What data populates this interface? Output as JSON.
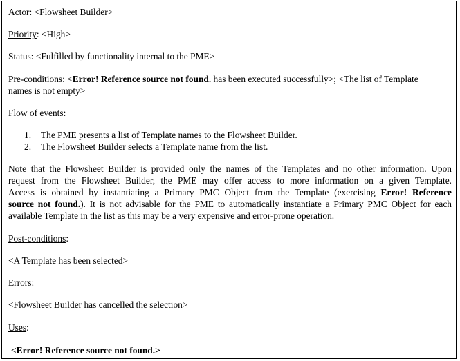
{
  "actor": {
    "label": "Actor",
    "value": "<Flowsheet Builder>"
  },
  "priority": {
    "label": "Priority",
    "value": "<High>"
  },
  "status": {
    "label": "Status",
    "value": "<Fulfilled by functionality internal to the PME>"
  },
  "preconditions": {
    "label": "Pre-conditions",
    "open": "<",
    "error": "Error! Reference source not found.",
    "rest_line1": " has been executed successfully>; <The list of Template",
    "rest_line2": "names is not empty>"
  },
  "flow": {
    "label": "Flow of events",
    "steps": [
      {
        "num": "1.",
        "text": "The PME presents a list of Template names to the Flowsheet Builder."
      },
      {
        "num": "2.",
        "text": "The Flowsheet Builder selects a Template name from the list."
      }
    ]
  },
  "note": {
    "line1": "Note that the Flowsheet Builder is provided only the names of the Templates and no other information. Upon",
    "line2": "request from the Flowsheet Builder, the PME may offer access to more information on a given Template.",
    "line3_start": "Access is obtained by instantiating a Primary PMC Object from the Template (exercising ",
    "error_a": "Error! Reference",
    "error_b": "source not found.",
    "line4_rest": "). It is not advisable for the PME to automatically instantiate a Primary PMC Object for each",
    "line5": "available Template in the list as this may be a very expensive and error-prone operation."
  },
  "postconditions": {
    "label": "Post-conditions",
    "value": "<A Template has been selected>"
  },
  "errors": {
    "label": "Errors",
    "value": "<Flowsheet Builder has cancelled the selection>"
  },
  "uses": {
    "label": "Uses",
    "open": "<",
    "error": "Error! Reference source not found.",
    "close": ">"
  }
}
